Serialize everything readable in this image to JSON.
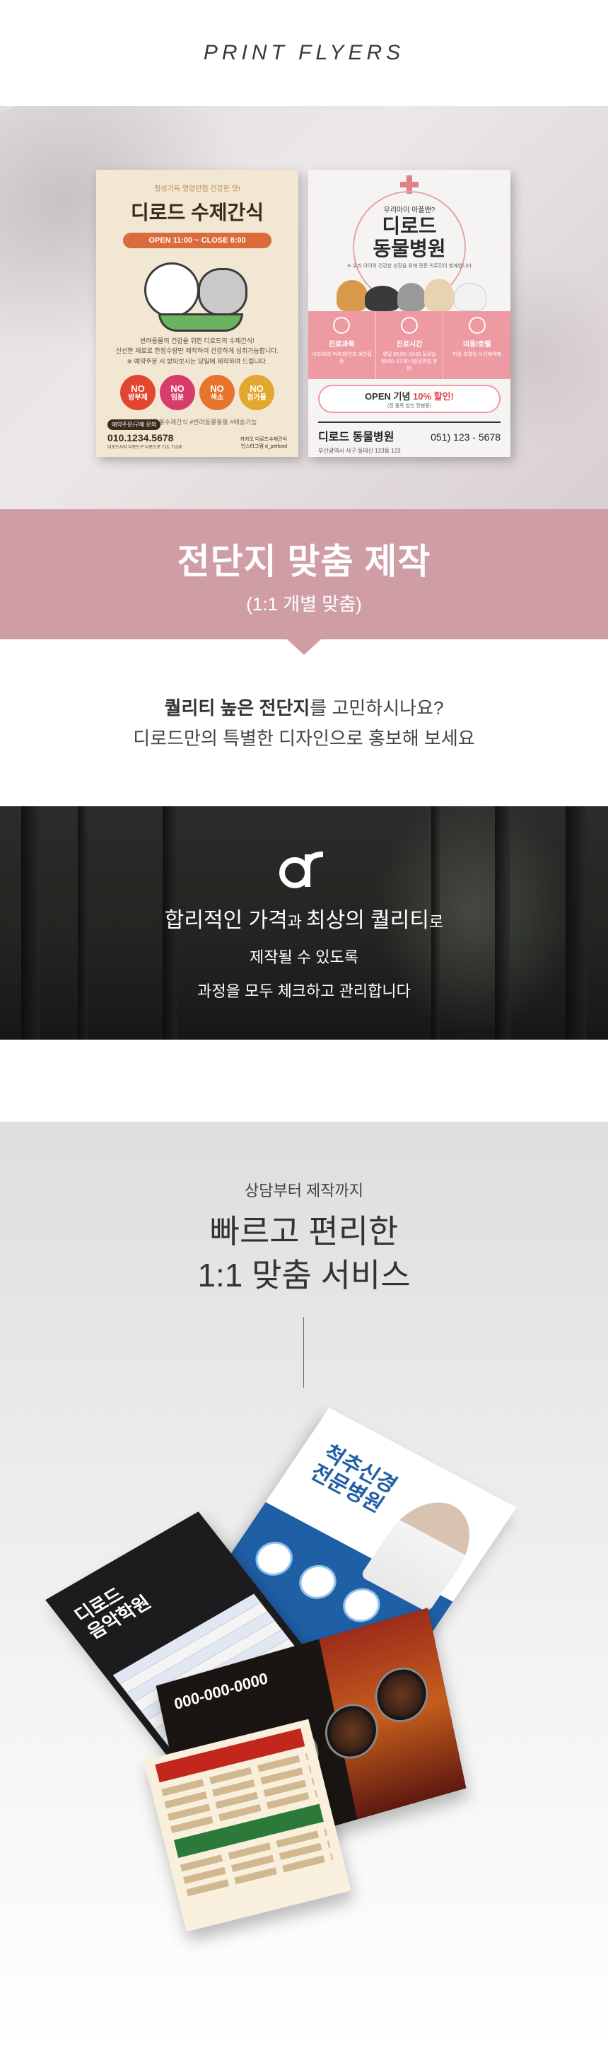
{
  "header": {
    "title": "PRINT FLYERS"
  },
  "flyer_a": {
    "top_text": "정성가득 영양만점 건강한 맛!",
    "title": "디로드 수제간식",
    "hours": "OPEN 11:00 ~ CLOSE 8:00",
    "desc_1": "반려동물의 건강을 위한 디로드의 수제간식!",
    "desc_2": "신선한 재료로 한정수량만 제작하여 건강하게 섭취가능합니다.",
    "desc_3": "※ 예약주문 시 받아보시는 당일에 제작하여 드립니다.",
    "circles": [
      {
        "no": "NO",
        "label": "방부제",
        "color": "#e3452f"
      },
      {
        "no": "NO",
        "label": "임분",
        "color": "#d83c6b"
      },
      {
        "no": "NO",
        "label": "색소",
        "color": "#e8732c"
      },
      {
        "no": "NO",
        "label": "첨가물",
        "color": "#e2a72e"
      }
    ],
    "tags": "#반려동물수제간식  #반려동물통통  #배송가능",
    "chip": "예약주문/구매 문의",
    "phone": "010.1234.5678",
    "addr": "디로드시티 디로드구 디로드로 713, 713호",
    "sns_1": "카카오 디로드수제간식",
    "sns_2": "인스타그램 d_petfood"
  },
  "flyer_b": {
    "top_text": "우리아이 아플땐?",
    "title_1": "디로드",
    "title_2": "동물병원",
    "sub": "※ 우리 아이의 건강한 성장을 위해 전문 의료진이 함께합니다",
    "cols": [
      {
        "title": "진료과목",
        "text": "내과/외과 피부과/안과 예방접종"
      },
      {
        "title": "진료시간",
        "text": "평일 09:00~19:00 토요일 09:00~17:00 (일/공휴일 휴진)"
      },
      {
        "title": "미용/호텔",
        "text": "미용 호텔링 사전예약제"
      }
    ],
    "open_prefix": "OPEN 기념 ",
    "open_discount": "10% 할인!",
    "open_sub": "(전 품목 할인 진행중)",
    "name": "디로드 동물병원",
    "phone": "051) 123 - 5678",
    "addr": "부산광역시 서구 동대신 123동 123"
  },
  "banner": {
    "title": "전단지 맞춤 제작",
    "subtitle": "(1:1 개별 맞춤)"
  },
  "question": {
    "line1_bold": "퀄리티 높은 전단지",
    "line1_rest": "를 고민하시나요?",
    "line2": "디로드만의 특별한 디자인으로 홍보해 보세요"
  },
  "forest": {
    "line1_a": "합리적인 가격",
    "line1_b": "과 ",
    "line1_c": "최상의 퀄리티",
    "line1_d": "로",
    "line2": "제작될 수 있도록",
    "line3": "과정을 모두 체크하고 관리합니다"
  },
  "service": {
    "small": "상담부터 제작까지",
    "big_1": "빠르고 편리한",
    "big_2": "1:1 맞춤 서비스"
  },
  "mockups": {
    "hospital_title_1": "척추신경",
    "hospital_title_2": "전문병원",
    "music_title_1": "디로드",
    "music_title_2": "음악학원",
    "food_phone": "000-000-0000"
  },
  "colors": {
    "banner": "#cf9ea5",
    "forest": "#222521",
    "flyer_b_pink": "#ee9aa2"
  },
  "icons": {
    "logo": "dr-logo-icon"
  }
}
